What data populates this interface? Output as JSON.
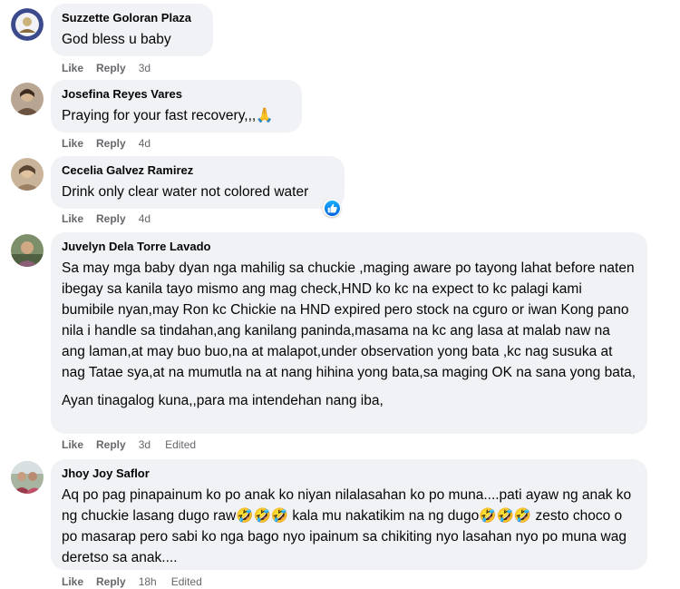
{
  "comments": [
    {
      "author": "Suzzette Goloran Plaza",
      "text": [
        "God bless u baby"
      ],
      "like_label": "Like",
      "reply_label": "Reply",
      "time": "3d",
      "edited": ""
    },
    {
      "author": "Josefina Reyes Vares",
      "text": [
        "Praying for your fast recovery,,,🙏"
      ],
      "like_label": "Like",
      "reply_label": "Reply",
      "time": "4d",
      "edited": ""
    },
    {
      "author": "Cecelia Galvez Ramirez",
      "text": [
        "Drink only clear water not colored water"
      ],
      "like_label": "Like",
      "reply_label": "Reply",
      "time": "4d",
      "edited": "",
      "reaction": "like-reaction-icon"
    },
    {
      "author": "Juvelyn Dela Torre Lavado",
      "text": [
        "Sa may mga baby dyan nga mahilig sa chuckie ,maging aware po tayong lahat before naten ibegay sa kanila tayo mismo ang mag check,HND ko kc na expect to kc palagi kami bumibile nyan,may Ron kc Chickie na HND expired pero stock na cguro or iwan Kong pano nila i handle sa tindahan,ang kanilang paninda,masama na kc ang lasa at malab naw na ang laman,at may buo buo,na at malapot,under observation yong bata ,kc nag susuka at nag Tatae sya,at na mumutla na at nang hihina yong bata,sa maging OK na sana yong bata,",
        "Ayan tinagalog kuna,,para ma intendehan nang iba,"
      ],
      "like_label": "Like",
      "reply_label": "Reply",
      "time": "3d",
      "edited": "Edited"
    },
    {
      "author": "Jhoy Joy Saflor",
      "text": [
        "Aq po pag pinapainum ko po anak ko niyan nilalasahan ko po muna....pati ayaw ng anak ko ng chuckie lasang dugo raw🤣🤣🤣 kala mu nakatikim na ng dugo🤣🤣🤣 zesto choco o po masarap pero sabi ko nga bago nyo ipainum sa chikiting nyo lasahan nyo po muna wag deretso sa anak...."
      ],
      "like_label": "Like",
      "reply_label": "Reply",
      "time": "18h",
      "edited": "Edited"
    }
  ],
  "colors": {
    "bubble": "#f0f2f5",
    "meta": "#65676b",
    "like_reaction": "#1877f2"
  }
}
